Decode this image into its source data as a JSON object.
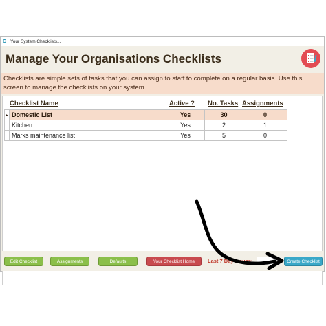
{
  "window": {
    "title": "Your System Checklists...",
    "app_icon": "C"
  },
  "header": {
    "title": "Manage Your Organisations Checklists",
    "logo_icon": "checklist-icon",
    "logo_color": "#e34b53"
  },
  "description": "Checklists are simple sets of tasks that you can assign to staff to complete on a regular basis.  Use this screen to manage the checklists on your system.",
  "table": {
    "columns": [
      "Checklist Name",
      "Active ?",
      "No. Tasks",
      "Assignments"
    ],
    "rows": [
      {
        "name": "Domestic List",
        "active": "Yes",
        "tasks": "30",
        "assignments": "0",
        "selected": true
      },
      {
        "name": "Kitchen",
        "active": "Yes",
        "tasks": "2",
        "assignments": "1",
        "selected": false
      },
      {
        "name": "Marks maintenance list",
        "active": "Yes",
        "tasks": "5",
        "assignments": "0",
        "selected": false
      }
    ],
    "record_selector": "▸"
  },
  "footer": {
    "buttons": {
      "edit_checklist": "Edit Checklist",
      "assignments": "Assignments",
      "defaults": "Defaults",
      "home": "Your Checklist Home",
      "create": "Create Checklist"
    },
    "issues_label": "Last 7 Day Issues:",
    "issues_value": ""
  },
  "colors": {
    "accent_peach": "#f7dccb",
    "button_green": "#8bbf4a",
    "button_red": "#c84a4e",
    "button_blue": "#3aa8c8",
    "issues_red": "#c0392b"
  }
}
